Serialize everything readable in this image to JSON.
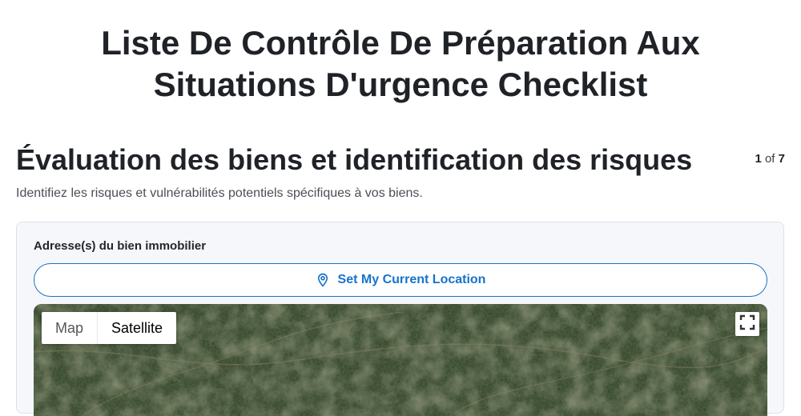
{
  "page": {
    "title": "Liste De Contrôle De Préparation Aux Situations D'urgence Checklist"
  },
  "section": {
    "title": "Évaluation des biens et identification des risques",
    "description": "Identifiez les risques et vulnérabilités potentiels spécifiques à vos biens.",
    "step_current": "1",
    "step_separator": "of",
    "step_total": "7"
  },
  "form": {
    "address_label": "Adresse(s) du bien immobilier",
    "location_button_label": "Set My Current Location",
    "location_icon": "map-pin-icon"
  },
  "map": {
    "type_options": [
      "Map",
      "Satellite"
    ],
    "selected_type": "Satellite",
    "fullscreen_icon": "fullscreen-icon"
  },
  "colors": {
    "accent": "#1673cc",
    "card_bg": "#f5f7fa"
  }
}
